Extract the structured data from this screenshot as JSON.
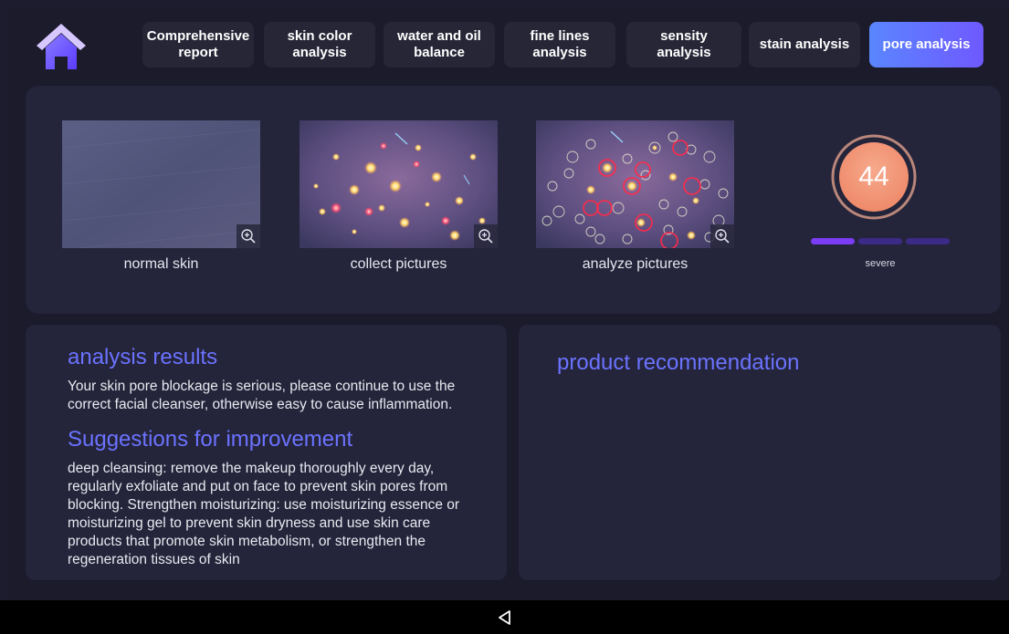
{
  "header": {
    "home_icon": "home-icon",
    "tabs": [
      {
        "label": "Comprehensive report",
        "active": false
      },
      {
        "label": "skin color analysis",
        "active": false
      },
      {
        "label": "water and oil balance",
        "active": false
      },
      {
        "label": "fine lines analysis",
        "active": false
      },
      {
        "label": "sensity analysis",
        "active": false
      },
      {
        "label": "stain analysis",
        "active": false
      },
      {
        "label": "pore analysis",
        "active": true
      }
    ]
  },
  "pictures": [
    {
      "label": "normal skin",
      "zoom_icon": "zoom-in-icon"
    },
    {
      "label": "collect pictures",
      "zoom_icon": "zoom-in-icon"
    },
    {
      "label": "analyze pictures",
      "zoom_icon": "zoom-in-icon"
    }
  ],
  "score": {
    "value": "44",
    "level_text": "severe",
    "level_fraction": 0.333
  },
  "results": {
    "title": "analysis results",
    "text": "Your skin pore blockage is serious, please continue to use the correct facial cleanser, otherwise easy to cause inflammation.",
    "suggestions_title": "Suggestions for improvement",
    "suggestions_text": "deep cleansing: remove the makeup thoroughly every day, regularly exfoliate and put on face to prevent skin pores from blocking. Strengthen moisturizing: use moisturizing essence or moisturizing gel to prevent skin dryness and use skin care products that promote skin metabolism, or strengthen the regeneration tissues of skin"
  },
  "product": {
    "title": "product recommendation"
  },
  "navbar": {
    "back_icon": "back-triangle-icon"
  },
  "colors": {
    "accent": "#6b73ff",
    "tab_active_start": "#5a86ff",
    "tab_active_end": "#6f59ff",
    "score_fill": "#f39a78",
    "level_on": "#7b3cf5",
    "level_off": "#3b2a86"
  }
}
